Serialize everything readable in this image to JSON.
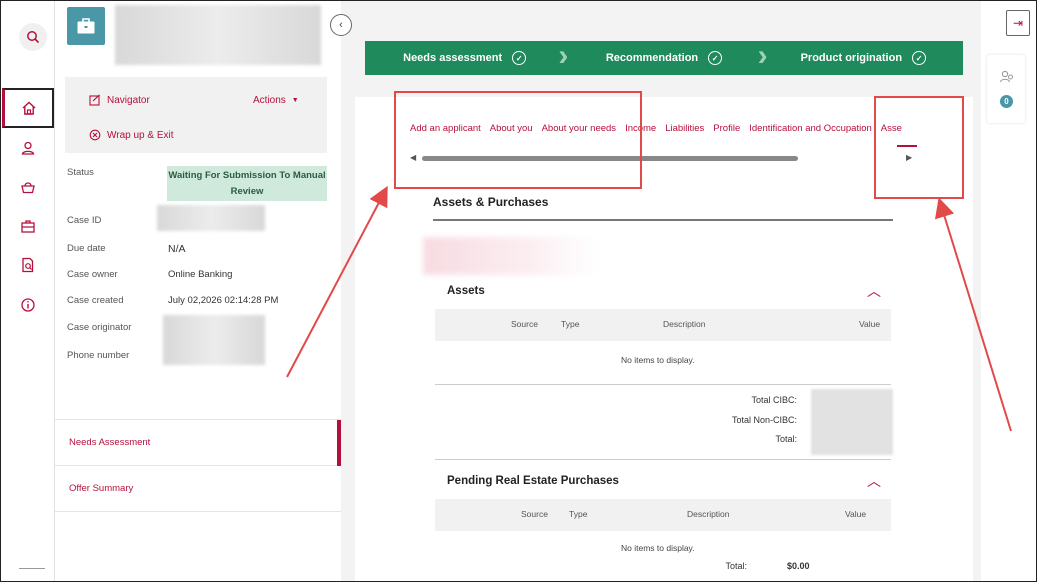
{
  "rail": {
    "items": [
      {
        "name": "search-icon"
      },
      {
        "name": "home-icon",
        "active": true
      },
      {
        "name": "user-icon"
      },
      {
        "name": "basket-icon"
      },
      {
        "name": "briefcase-icon"
      },
      {
        "name": "document-search-icon"
      },
      {
        "name": "info-icon"
      }
    ]
  },
  "case_panel": {
    "navigator": "Navigator",
    "actions": "Actions",
    "wrap_up": "Wrap up & Exit",
    "fields": {
      "status_label": "Status",
      "status_value": "Waiting For Submission To Manual Review",
      "case_id_label": "Case ID",
      "due_date_label": "Due date",
      "due_date_value": "N/A",
      "case_owner_label": "Case owner",
      "case_owner_value": "Online Banking",
      "case_created_label": "Case created",
      "case_created_value": "July 02,2026 02:14:28 PM",
      "case_originator_label": "Case originator",
      "phone_label": "Phone number"
    },
    "nav": {
      "needs_assessment": "Needs Assessment",
      "offer_summary": "Offer Summary"
    }
  },
  "stepper": {
    "steps": [
      "Needs assessment",
      "Recommendation",
      "Product origination"
    ]
  },
  "tabs": [
    "Add an applicant",
    "About you",
    "About your needs",
    "Income",
    "Liabilities",
    "Profile",
    "Identification and Occupation",
    "Asse"
  ],
  "content": {
    "section_title": "Assets & Purchases",
    "assets": {
      "heading": "Assets",
      "col_source": "Source",
      "col_type": "Type",
      "col_description": "Description",
      "col_value": "Value",
      "empty": "No items to display.",
      "total_cibc": "Total CIBC:",
      "total_non_cibc": "Total Non-CIBC:",
      "total": "Total:"
    },
    "pending": {
      "heading": "Pending Real Estate Purchases",
      "col_source": "Source",
      "col_type": "Type",
      "col_description": "Description",
      "col_value": "Value",
      "empty": "No items to display.",
      "total_label": "Total:",
      "total_value": "$0.00"
    }
  },
  "right_panel": {
    "applicant_count": "0"
  },
  "colors": {
    "brand_red": "#b5103c",
    "step_green": "#1f8a5b",
    "teal": "#4a97a8",
    "status_bg": "#cfe9dd",
    "annotation_red": "#e24a4a"
  }
}
